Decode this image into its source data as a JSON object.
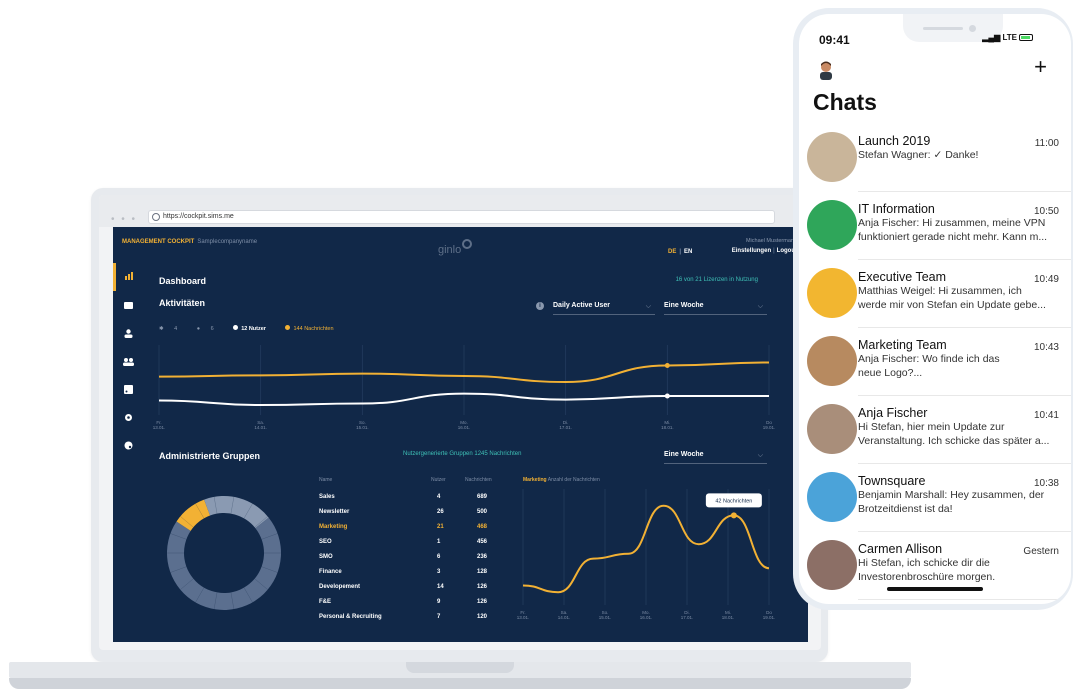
{
  "browser": {
    "url": "https://cockpit.sims.me",
    "dots": "• • •"
  },
  "app": {
    "header": {
      "brand": "MANAGEMENT COCKPIT",
      "company": "Samplecompanyname",
      "logo": "ginlo",
      "lang_de": "DE",
      "lang_sep": "|",
      "lang_en": "EN",
      "user_name": "Michael Mustermann",
      "settings": "Einstellungen",
      "link_sep": "|",
      "logout": "Logout"
    },
    "sidebar": {
      "icons": [
        "dashboard-icon",
        "chat-icon",
        "user-icon",
        "users-icon",
        "rss-icon",
        "gear-icon",
        "palette-icon"
      ]
    },
    "dashboard_title": "Dashboard",
    "license_text": "16 von 21 Lizenzen in Nutzung",
    "activities": {
      "title": "Aktivitäten",
      "info": "i",
      "metric_dropdown": "Daily Active User",
      "period_dropdown": "Eine Woche",
      "legend": {
        "android": "4",
        "apple": "6",
        "users": "12 Nutzer",
        "messages": "144 Nachrichten"
      }
    },
    "groups": {
      "title": "Administrierte Gruppen",
      "center_text": "Nutzergenerierte Gruppen 1245 Nachrichten",
      "period_dropdown": "Eine Woche",
      "table_headers": {
        "name": "Name",
        "users": "Nutzer",
        "messages": "Nachrichten"
      },
      "rows": [
        {
          "name": "Sales",
          "users": "4",
          "messages": "689"
        },
        {
          "name": "Newsletter",
          "users": "26",
          "messages": "500"
        },
        {
          "name": "Marketing",
          "users": "21",
          "messages": "468"
        },
        {
          "name": "SEO",
          "users": "1",
          "messages": "456"
        },
        {
          "name": "SMO",
          "users": "6",
          "messages": "236"
        },
        {
          "name": "Finance",
          "users": "3",
          "messages": "128"
        },
        {
          "name": "Developement",
          "users": "14",
          "messages": "126"
        },
        {
          "name": "F&E",
          "users": "9",
          "messages": "126"
        },
        {
          "name": "Personal & Recruiting",
          "users": "7",
          "messages": "120"
        }
      ],
      "marketing_label": "Marketing",
      "marketing_sublabel": "Anzahl der Nachrichten",
      "tooltip": "42 Nachrichten"
    },
    "colors": {
      "navy": "#112848",
      "orange": "#f2b134",
      "teal": "#3ec0b6"
    }
  },
  "chart_data": [
    {
      "type": "line",
      "categories": [
        "Fr. 13.01.",
        "Sa. 14.01.",
        "So. 15.01.",
        "Mo. 16.01.",
        "Di. 17.01.",
        "Mi. 18.01.",
        "Do 19.01."
      ],
      "series": [
        {
          "name": "144 Nachrichten",
          "color": "#f2b134",
          "values": [
            0.72,
            0.68,
            0.62,
            0.7,
            0.9,
            0.35,
            0.25
          ]
        },
        {
          "name": "12 Nutzer",
          "color": "#ffffff",
          "values": [
            0.85,
            1.0,
            0.95,
            0.62,
            0.82,
            0.7,
            0.7
          ]
        }
      ],
      "grid": true
    },
    {
      "type": "pie",
      "values": [
        70,
        10,
        20
      ],
      "highlight": "Marketing",
      "colors": [
        "#5b6f8f",
        "#f2b134",
        "#8a9ab2"
      ]
    },
    {
      "type": "line",
      "categories": [
        "Fr. 13.01.",
        "Sa. 14.01.",
        "So. 15.01.",
        "Mo. 16.01.",
        "Di. 17.01.",
        "Mi. 18.01.",
        "Do 19.01."
      ],
      "series": [
        {
          "name": "Marketing",
          "color": "#f2b134",
          "values": [
            0.12,
            0.05,
            0.4,
            0.45,
            0.95,
            0.55,
            0.85,
            0.3
          ]
        }
      ],
      "tooltip_value": "42 Nachrichten",
      "grid": true
    }
  ],
  "phone": {
    "time": "09:41",
    "signal": "LTE",
    "title": "Chats",
    "plus": "+",
    "chats": [
      {
        "name": "Launch 2019",
        "time": "11:00",
        "preview": "Stefan Wagner: ✓ Danke!",
        "avatar": "#c9b59a"
      },
      {
        "name": "IT Information",
        "time": "10:50",
        "preview": "Anja Fischer:  Hi zusammen, meine VPN\nfunktioniert gerade nicht mehr. Kann m...",
        "avatar": "#2fa65a"
      },
      {
        "name": "Executive Team",
        "time": "10:49",
        "preview": "Matthias Weigel: Hi zusammen, ich\nwerde mir von Stefan ein Update gebe...",
        "avatar": "#f2b630"
      },
      {
        "name": "Marketing Team",
        "time": "10:43",
        "preview": "Anja Fischer:  Wo finde ich das\nneue Logo?...",
        "avatar": "#b78a60"
      },
      {
        "name": "Anja Fischer",
        "time": "10:41",
        "preview": "Hi Stefan, hier mein Update zur\nVeranstaltung. Ich schicke das später a...",
        "avatar": "#a98e7a"
      },
      {
        "name": "Townsquare",
        "time": "10:38",
        "preview": "Benjamin Marshall:  Hey zusammen, der\nBrotzeitdienst ist da!",
        "avatar": "#4ba3d9"
      },
      {
        "name": "Carmen Allison",
        "time": "Gestern",
        "preview": "Hi Stefan, ich schicke dir die\nInvestorenbroschüre morgen.",
        "avatar": "#8c6f66"
      }
    ]
  }
}
